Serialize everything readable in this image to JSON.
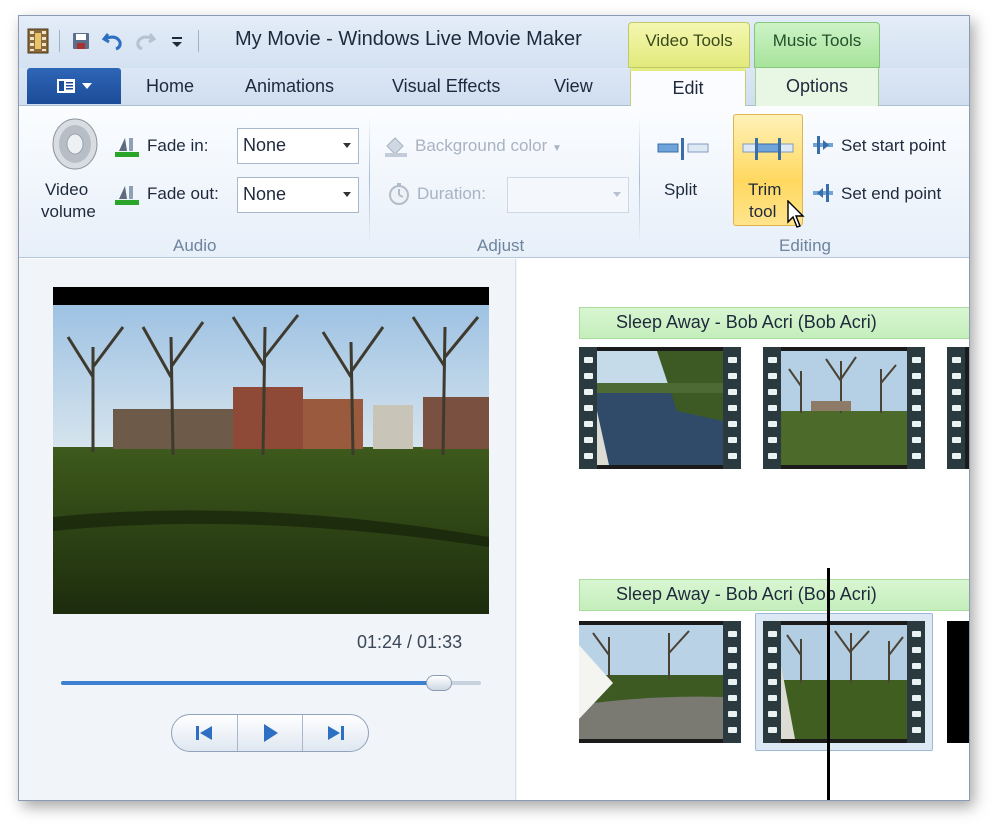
{
  "window": {
    "title": "My Movie - Windows Live Movie Maker"
  },
  "quick_access": {
    "icons": [
      "movie-maker-app-icon",
      "save-icon",
      "undo-icon",
      "redo-icon",
      "customize-toolbar-icon"
    ]
  },
  "context_groups": {
    "video_tools": "Video Tools",
    "music_tools": "Music Tools"
  },
  "tabs": {
    "home": "Home",
    "animations": "Animations",
    "visual_effects": "Visual Effects",
    "view": "View",
    "edit": "Edit",
    "options": "Options"
  },
  "ribbon": {
    "audio": {
      "group_label": "Audio",
      "video_volume_line1": "Video",
      "video_volume_line2": "volume",
      "fade_in_label": "Fade in:",
      "fade_in_value": "None",
      "fade_out_label": "Fade out:",
      "fade_out_value": "None"
    },
    "adjust": {
      "group_label": "Adjust",
      "background_color_label": "Background color",
      "duration_label": "Duration:",
      "duration_value": ""
    },
    "editing": {
      "group_label": "Editing",
      "split_label": "Split",
      "trim_line1": "Trim",
      "trim_line2": "tool",
      "set_start_label": "Set start point",
      "set_end_label": "Set end point"
    }
  },
  "preview": {
    "timecode": "01:24 / 01:33",
    "progress_fraction": 0.9
  },
  "storyboard": {
    "tracks": [
      {
        "music_label": "Sleep Away - Bob Acri (Bob Acri)"
      },
      {
        "music_label": "Sleep Away - Bob Acri (Bob Acri)"
      }
    ]
  },
  "colors": {
    "accent_blue": "#3d7fd1",
    "video_tools_yellow": "#e2ea7c",
    "music_tools_green": "#a7e39b",
    "trim_highlight": "#ffd860"
  }
}
